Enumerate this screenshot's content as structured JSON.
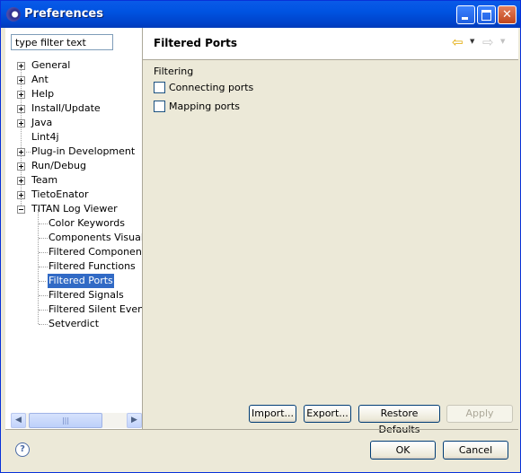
{
  "window": {
    "title": "Preferences",
    "title_icon": "eclipse-icon",
    "controls": [
      "minimize",
      "maximize",
      "close"
    ]
  },
  "filter": {
    "placeholder": "type filter text"
  },
  "tree": {
    "items": [
      {
        "label": "General",
        "level": 0,
        "expander": "plus"
      },
      {
        "label": "Ant",
        "level": 0,
        "expander": "plus"
      },
      {
        "label": "Help",
        "level": 0,
        "expander": "plus"
      },
      {
        "label": "Install/Update",
        "level": 0,
        "expander": "plus"
      },
      {
        "label": "Java",
        "level": 0,
        "expander": "plus"
      },
      {
        "label": "Lint4j",
        "level": 0,
        "expander": "none"
      },
      {
        "label": "Plug-in Development",
        "level": 0,
        "expander": "plus"
      },
      {
        "label": "Run/Debug",
        "level": 0,
        "expander": "plus"
      },
      {
        "label": "Team",
        "level": 0,
        "expander": "plus"
      },
      {
        "label": "TietoEnator",
        "level": 0,
        "expander": "plus"
      },
      {
        "label": "TITAN Log Viewer",
        "level": 0,
        "expander": "minus"
      },
      {
        "label": "Color Keywords",
        "level": 1,
        "expander": "none"
      },
      {
        "label": "Components Visual O",
        "level": 1,
        "expander": "none"
      },
      {
        "label": "Filtered Components",
        "level": 1,
        "expander": "none"
      },
      {
        "label": "Filtered Functions",
        "level": 1,
        "expander": "none"
      },
      {
        "label": "Filtered Ports",
        "level": 1,
        "expander": "none",
        "selected": true
      },
      {
        "label": "Filtered Signals",
        "level": 1,
        "expander": "none"
      },
      {
        "label": "Filtered Silent Events",
        "level": 1,
        "expander": "none"
      },
      {
        "label": "Setverdict",
        "level": 1,
        "expander": "none"
      }
    ]
  },
  "scrollbar": {
    "left_arrow": "◀",
    "right_arrow": "▶",
    "grip": "|||"
  },
  "page": {
    "title": "Filtered Ports",
    "nav_back_icon": "back-arrow-icon",
    "nav_forward_icon": "forward-arrow-icon",
    "group_label": "Filtering",
    "checkboxes": [
      {
        "label": "Connecting ports",
        "checked": false
      },
      {
        "label": "Mapping ports",
        "checked": false
      }
    ]
  },
  "buttons": {
    "import": "Import...",
    "export": "Export...",
    "restore_defaults": "Restore Defaults",
    "apply": "Apply",
    "ok": "OK",
    "cancel": "Cancel"
  },
  "help": {
    "glyph": "?"
  },
  "colors": {
    "title_bar": "#0053e1",
    "selection": "#316ac5",
    "dialog_background": "#ece9d8"
  }
}
